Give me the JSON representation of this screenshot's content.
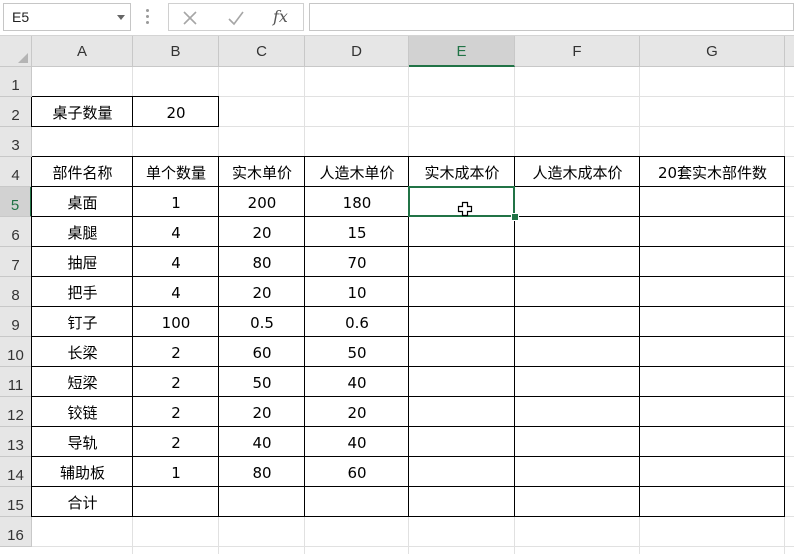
{
  "formula_bar": {
    "name_box": "E5",
    "cancel_icon": "close-icon",
    "enter_icon": "check-icon",
    "function_label": "fx",
    "formula": ""
  },
  "sheet": {
    "columns": [
      "A",
      "B",
      "C",
      "D",
      "E",
      "F",
      "G"
    ],
    "rows": [
      "1",
      "2",
      "3",
      "4",
      "5",
      "6",
      "7",
      "8",
      "9",
      "10",
      "11",
      "12",
      "13",
      "14",
      "15",
      "16"
    ],
    "selected_cell": "E5",
    "desk_count": {
      "label": "桌子数量",
      "value": "20"
    },
    "table": {
      "headers": [
        "部件名称",
        "单个数量",
        "实木单价",
        "人造木单价",
        "实木成本价",
        "人造木成本价",
        "20套实木部件数"
      ],
      "rows": [
        [
          "桌面",
          "1",
          "200",
          "180",
          "",
          "",
          ""
        ],
        [
          "桌腿",
          "4",
          "20",
          "15",
          "",
          "",
          ""
        ],
        [
          "抽屉",
          "4",
          "80",
          "70",
          "",
          "",
          ""
        ],
        [
          "把手",
          "4",
          "20",
          "10",
          "",
          "",
          ""
        ],
        [
          "钉子",
          "100",
          "0.5",
          "0.6",
          "",
          "",
          ""
        ],
        [
          "长梁",
          "2",
          "60",
          "50",
          "",
          "",
          ""
        ],
        [
          "短梁",
          "2",
          "50",
          "40",
          "",
          "",
          ""
        ],
        [
          "铰链",
          "2",
          "20",
          "20",
          "",
          "",
          ""
        ],
        [
          "导轨",
          "2",
          "40",
          "40",
          "",
          "",
          ""
        ],
        [
          "辅助板",
          "1",
          "80",
          "60",
          "",
          "",
          ""
        ],
        [
          "合计",
          "",
          "",
          "",
          "",
          "",
          ""
        ]
      ]
    }
  },
  "colors": {
    "accent": "#217346",
    "header_bg": "#e6e6e6",
    "gridline": "#e1e1e1"
  }
}
